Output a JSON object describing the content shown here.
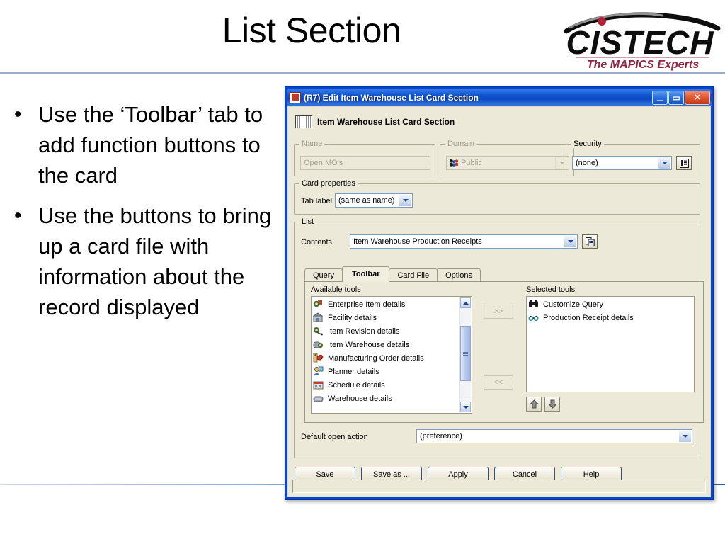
{
  "slide": {
    "title": "List Section",
    "bullets": [
      "Use the ‘Toolbar’ tab to add function buttons to the card",
      "Use the buttons to bring up a card file with information about the record displayed"
    ],
    "bullet_marker": "•"
  },
  "logo": {
    "name": "CISTECH",
    "tagline": "The MAPICS Experts",
    "colors": {
      "wordmark": "#0d0d0d",
      "tagline": "#8f2744",
      "dot": "#b3203a"
    }
  },
  "dialog": {
    "titlebar": {
      "title": "(R7) Edit Item Warehouse List Card Section",
      "icon": "app-icon",
      "minimize_label": "_",
      "maximize_label": "▭",
      "close_label": "✕",
      "accent": "#0a46c8"
    },
    "card_header": {
      "icon": "card-section-icon",
      "text": "Item Warehouse List Card Section"
    },
    "name_group": {
      "legend": "Name",
      "value": "Open MO's",
      "enabled": false
    },
    "domain_group": {
      "legend": "Domain",
      "value": "Public",
      "icon": "people-icon",
      "enabled": false
    },
    "security_group": {
      "legend": "Security",
      "value": "(none)",
      "browse_icon": "security-list-icon",
      "enabled": true
    },
    "card_properties": {
      "legend": "Card properties",
      "tab_label_caption": "Tab label",
      "tab_label_value": "(same as name)"
    },
    "list_group": {
      "legend": "List",
      "contents_caption": "Contents",
      "contents_value": "Item Warehouse Production Receipts",
      "contents_copy_icon": "copy-pages-icon",
      "tabs": [
        {
          "label": "Query",
          "active": false
        },
        {
          "label": "Toolbar",
          "active": true
        },
        {
          "label": "Card File",
          "active": false
        },
        {
          "label": "Options",
          "active": false
        }
      ],
      "available_tools": {
        "label": "Available tools",
        "items": [
          {
            "label": "Enterprise Item details",
            "icon": "enterprise-item-icon"
          },
          {
            "label": "Facility details",
            "icon": "facility-icon"
          },
          {
            "label": "Item Revision details",
            "icon": "item-revision-icon"
          },
          {
            "label": "Item Warehouse details",
            "icon": "item-warehouse-icon"
          },
          {
            "label": "Manufacturing Order details",
            "icon": "manufacturing-order-icon"
          },
          {
            "label": "Planner details",
            "icon": "planner-icon"
          },
          {
            "label": "Schedule details",
            "icon": "schedule-icon"
          },
          {
            "label": "Warehouse details",
            "icon": "warehouse-icon"
          }
        ]
      },
      "selected_tools": {
        "label": "Selected tools",
        "items": [
          {
            "label": "Customize Query",
            "icon": "binoculars-icon"
          },
          {
            "label": "Production Receipt details",
            "icon": "binoculars-small-icon"
          }
        ]
      },
      "add_button_label": ">>",
      "remove_button_label": "<<",
      "move_up_label": "↑",
      "move_down_label": "↓",
      "default_open_action_caption": "Default open action",
      "default_open_action_value": "(preference)"
    },
    "buttons": [
      {
        "label": "Save"
      },
      {
        "label": "Save as ..."
      },
      {
        "label": "Apply"
      },
      {
        "label": "Cancel"
      },
      {
        "label": "Help"
      }
    ],
    "statusbar": {
      "text": ""
    }
  }
}
